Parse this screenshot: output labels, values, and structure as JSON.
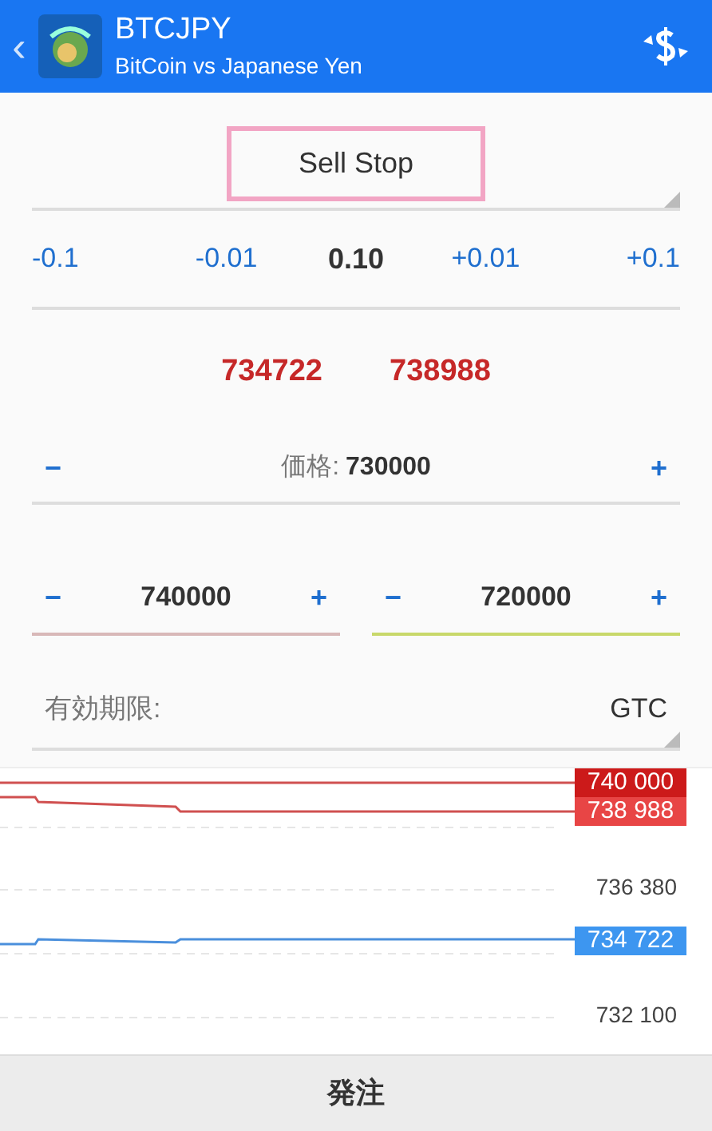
{
  "header": {
    "back": "‹",
    "title": "BTCJPY",
    "subtitle": "BitCoin vs Japanese Yen"
  },
  "order_type": {
    "value": "Sell Stop",
    "highlighted": true
  },
  "volume": {
    "steps": [
      "-0.1",
      "-0.01",
      "+0.01",
      "+0.1"
    ],
    "value": "0.10"
  },
  "quotes": {
    "bid": "734722",
    "ask": "738988"
  },
  "price": {
    "minus": "−",
    "label": "価格:",
    "value": "730000",
    "plus": "+"
  },
  "stops": [
    {
      "minus": "−",
      "value": "740000",
      "plus": "+",
      "color": "#d8b8b8"
    },
    {
      "minus": "−",
      "value": "720000",
      "plus": "+",
      "color": "#c8d86a"
    }
  ],
  "expiry": {
    "label": "有効期限:",
    "value": "GTC"
  },
  "price_chart": {
    "tags": [
      {
        "text": "740 000",
        "kind": "level",
        "color": "#cc1a1a"
      },
      {
        "text": "738 988",
        "kind": "ask",
        "color": "#e84545"
      },
      {
        "text": "734 722",
        "kind": "bid",
        "color": "#3d96f0"
      }
    ],
    "ticks": [
      "736 380",
      "732 100"
    ]
  },
  "submit": "発注"
}
